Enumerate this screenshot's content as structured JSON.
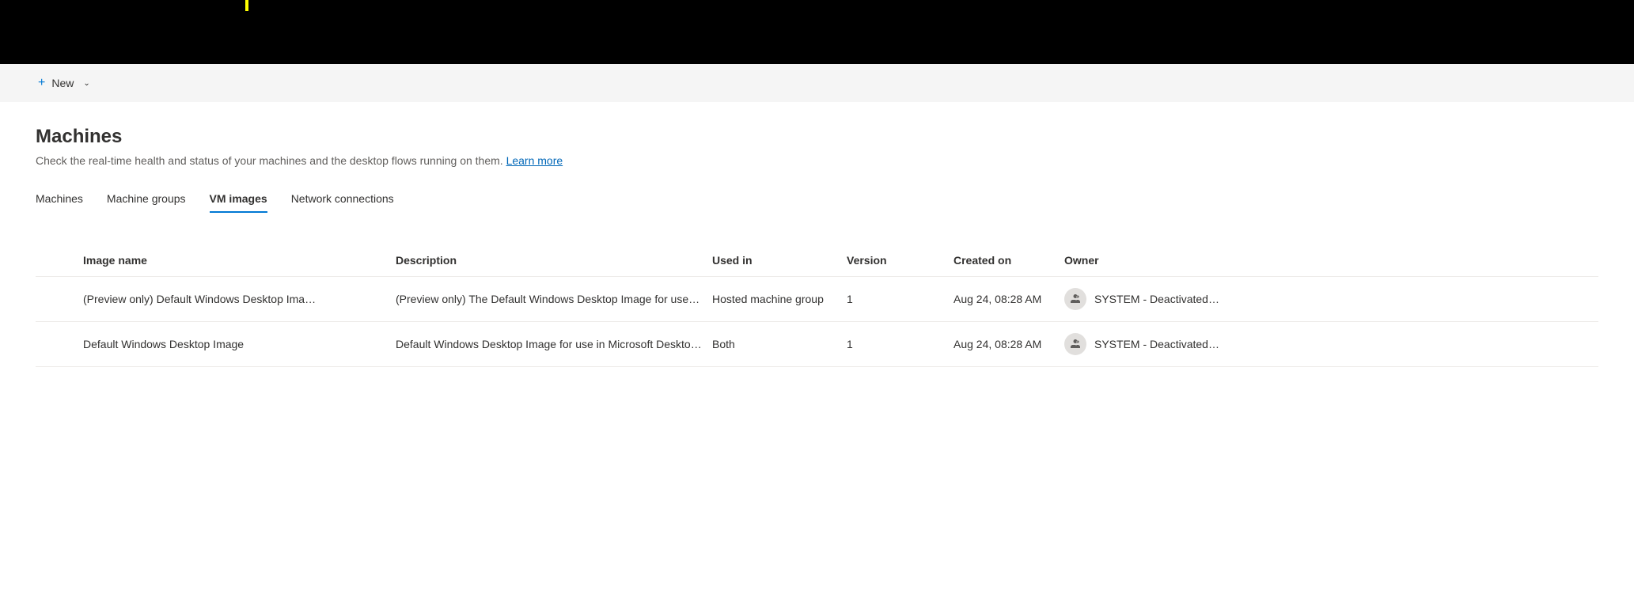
{
  "toolbar": {
    "new_label": "New"
  },
  "page": {
    "title": "Machines",
    "description": "Check the real-time health and status of your machines and the desktop flows running on them.",
    "learn_more": "Learn more"
  },
  "tabs": {
    "items": [
      {
        "label": "Machines",
        "active": false
      },
      {
        "label": "Machine groups",
        "active": false
      },
      {
        "label": "VM images",
        "active": true
      },
      {
        "label": "Network connections",
        "active": false
      }
    ]
  },
  "table": {
    "headers": {
      "name": "Image name",
      "description": "Description",
      "usedin": "Used in",
      "version": "Version",
      "created": "Created on",
      "owner": "Owner"
    },
    "rows": [
      {
        "name": "(Preview only) Default Windows Desktop Ima…",
        "description": "(Preview only) The Default Windows Desktop Image for use i…",
        "usedin": "Hosted machine group",
        "version": "1",
        "created": "Aug 24, 08:28 AM",
        "owner": "SYSTEM - Deactivated…"
      },
      {
        "name": "Default Windows Desktop Image",
        "description": "Default Windows Desktop Image for use in Microsoft Deskto…",
        "usedin": "Both",
        "version": "1",
        "created": "Aug 24, 08:28 AM",
        "owner": "SYSTEM - Deactivated…"
      }
    ]
  }
}
